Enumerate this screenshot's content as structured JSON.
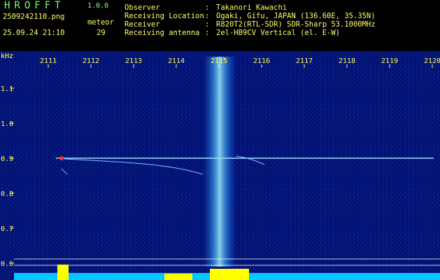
{
  "app": {
    "title": "HROFFT",
    "version": "1.0.0",
    "file_name": "2509242110.png",
    "date_time": "25.09.24 21:10",
    "meteor_label": "meteor",
    "meteor_count": "29"
  },
  "info": {
    "rows": [
      {
        "key": "Observer",
        "value": "Takanori Kawachi"
      },
      {
        "key": "Receiving Location",
        "value": "Ogaki, Gifu, JAPAN (136.60E, 35.35N)"
      },
      {
        "key": "Receiver",
        "value": "R820T2(RTL-SDR) SDR-Sharp 53.1000MHz"
      },
      {
        "key": "Receiving antenna",
        "value": "2el-HB9CV Vertical (el. E-W)"
      }
    ],
    "separator": ":"
  },
  "axes": {
    "unit": "kHz",
    "time_ticks": [
      "2111",
      "2112",
      "2113",
      "2114",
      "2115",
      "2116",
      "2117",
      "2118",
      "2119",
      "2120"
    ],
    "freq_ticks": [
      "1.1",
      "1.0",
      "0.9",
      "0.8",
      "0.7",
      "0.6"
    ]
  },
  "colors": {
    "background": "#00106e",
    "label": "#ffff66",
    "title": "#7dff7d",
    "signal": "#40b0ff",
    "meteor": "#ff3030",
    "echo_band": "#ffff00"
  }
}
